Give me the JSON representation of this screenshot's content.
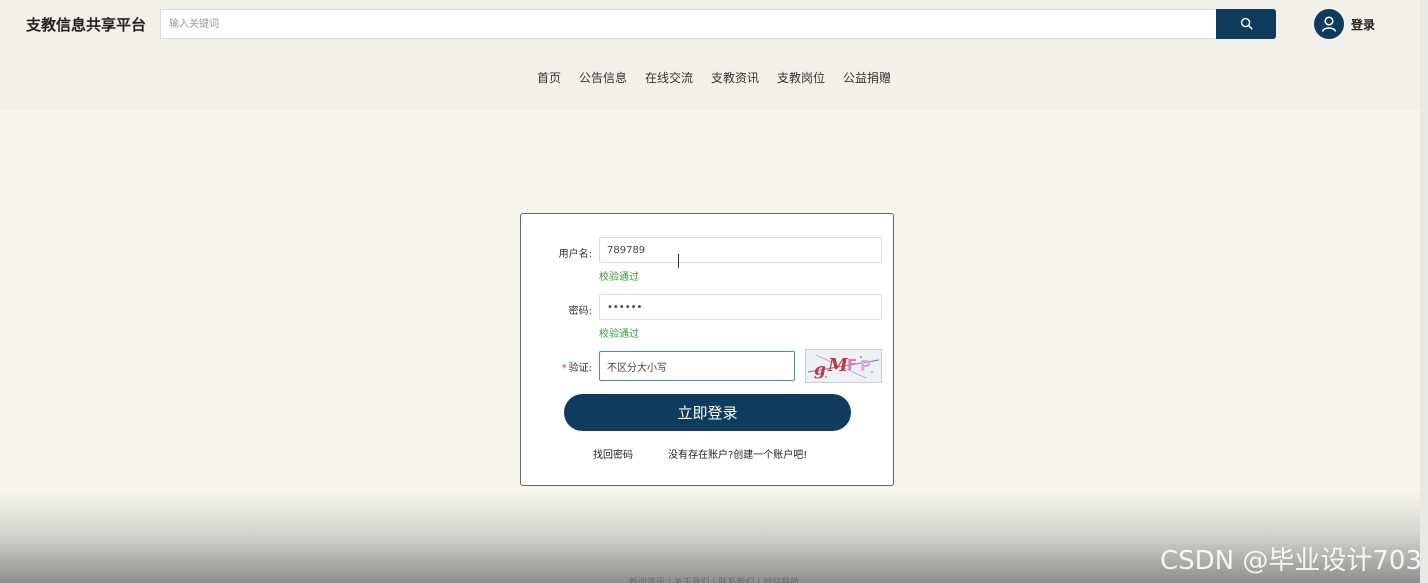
{
  "app": {
    "title": "支教信息共享平台"
  },
  "search": {
    "placeholder": "输入关键词",
    "button_icon": "search-icon"
  },
  "user": {
    "login_label": "登录",
    "icon": "user-avatar-icon"
  },
  "nav": {
    "items": [
      "首页",
      "公告信息",
      "在线交流",
      "支教资讯",
      "支教岗位",
      "公益捐赠"
    ]
  },
  "login_form": {
    "username": {
      "label": "用户名:",
      "value": "789789",
      "status": "校验通过"
    },
    "password": {
      "label": "密码:",
      "value": "••••••",
      "status": "校验通过"
    },
    "captcha": {
      "required_mark": "*",
      "label": "验证:",
      "value": "不区分大小写",
      "image_text": "gMFP"
    },
    "submit_label": "立即登录",
    "forgot_password": "找回密码",
    "register_prompt": "没有存在账户?创建一个账户吧!"
  },
  "footer": {
    "links": "新闻资讯 | 关于我们 | 联系我们 | 网站导航"
  },
  "watermark": "CSDN @毕业设计703",
  "colors": {
    "accent": "#0f3b5d",
    "success": "#3a9a3a",
    "background": "#f6f6ee"
  }
}
